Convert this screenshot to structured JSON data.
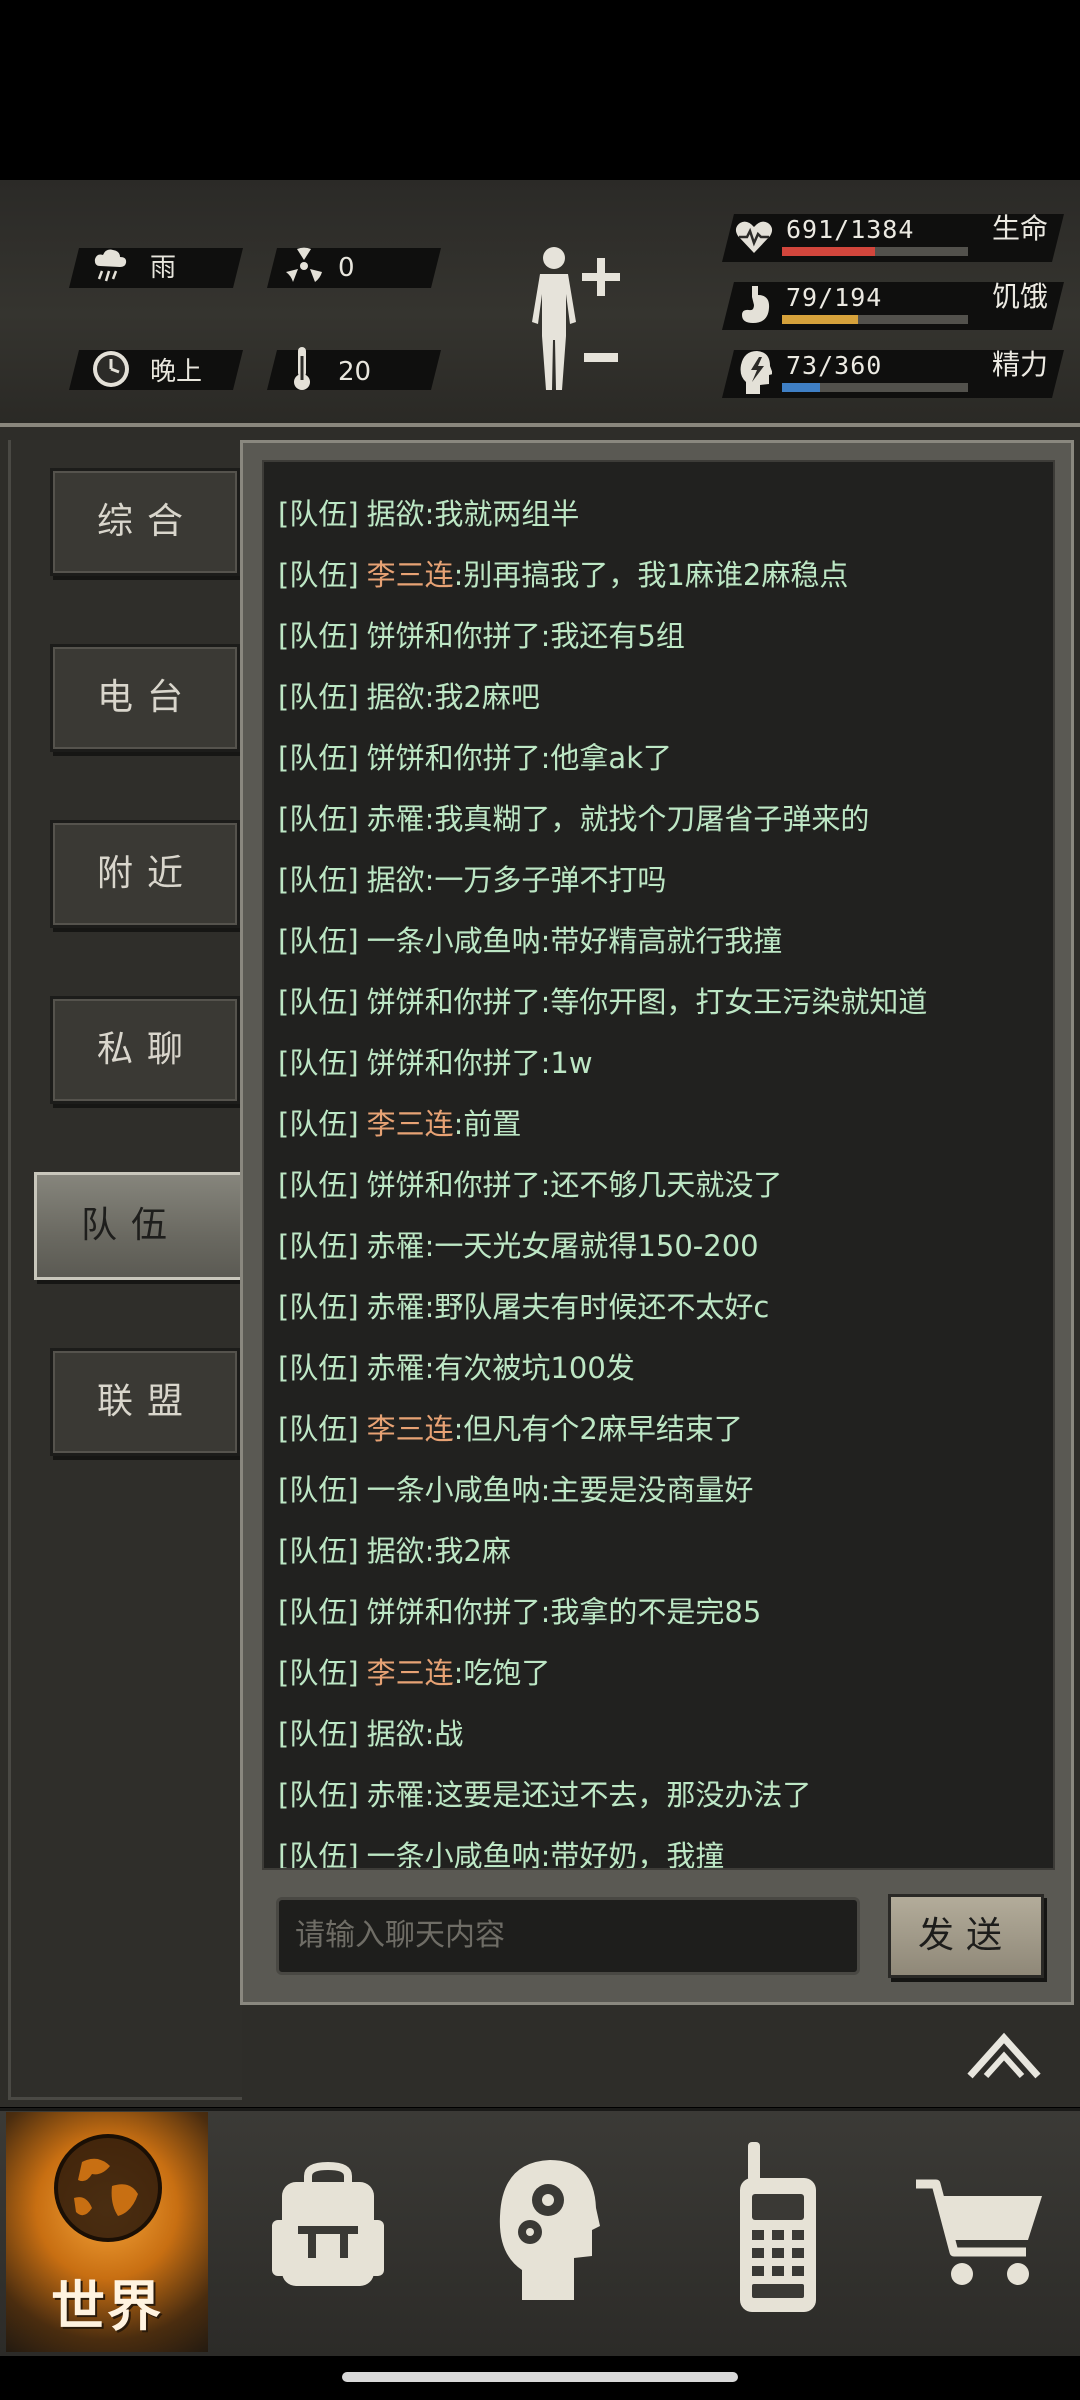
{
  "hud": {
    "weather": {
      "icon": "rain-cloud-icon",
      "label": "雨"
    },
    "radiation": {
      "icon": "radiation-icon",
      "value": "0"
    },
    "time_of_day": {
      "icon": "clock-icon",
      "label": "晚上"
    },
    "temperature": {
      "icon": "thermometer-icon",
      "value": "20"
    },
    "body": {
      "icon": "human-body-icon",
      "plus": "+",
      "minus": "−"
    },
    "stats": [
      {
        "name": "生命",
        "value": "691/1384",
        "fraction": 0.499,
        "color": "#d2463c",
        "icon": "heart-pulse-icon"
      },
      {
        "name": "饥饿",
        "value": "79/194",
        "fraction": 0.407,
        "color": "#d6a23b",
        "icon": "stomach-icon"
      },
      {
        "name": "精力",
        "value": "73/360",
        "fraction": 0.203,
        "color": "#3f7fc4",
        "icon": "head-energy-icon"
      }
    ]
  },
  "tabs": [
    {
      "label": "综合",
      "active": false
    },
    {
      "label": "电台",
      "active": false
    },
    {
      "label": "附近",
      "active": false
    },
    {
      "label": "私聊",
      "active": false
    },
    {
      "label": "队伍",
      "active": true
    },
    {
      "label": "联盟",
      "active": false
    }
  ],
  "chat": {
    "messages": [
      {
        "tag": "[队伍]",
        "sender": "据欲",
        "text": ":我就两组半",
        "highlight": false
      },
      {
        "tag": "[队伍]",
        "sender": "李三连",
        "text": ":别再搞我了，我1麻谁2麻稳点",
        "highlight": true
      },
      {
        "tag": "[队伍]",
        "sender": "饼饼和你拼了",
        "text": ":我还有5组",
        "highlight": false
      },
      {
        "tag": "[队伍]",
        "sender": "据欲",
        "text": ":我2麻吧",
        "highlight": false
      },
      {
        "tag": "[队伍]",
        "sender": "饼饼和你拼了",
        "text": ":他拿ak了",
        "highlight": false
      },
      {
        "tag": "[队伍]",
        "sender": "赤罹",
        "text": ":我真糊了，就找个刀屠省子弹来的",
        "highlight": false
      },
      {
        "tag": "[队伍]",
        "sender": "据欲",
        "text": ":一万多子弹不打吗",
        "highlight": false
      },
      {
        "tag": "[队伍]",
        "sender": "一条小咸鱼呐",
        "text": ":带好精高就行我撞",
        "highlight": false
      },
      {
        "tag": "[队伍]",
        "sender": "饼饼和你拼了",
        "text": ":等你开图，打女王污染就知道",
        "highlight": false
      },
      {
        "tag": "[队伍]",
        "sender": "饼饼和你拼了",
        "text": ":1w",
        "highlight": false
      },
      {
        "tag": "[队伍]",
        "sender": "李三连",
        "text": ":前置",
        "highlight": true
      },
      {
        "tag": "[队伍]",
        "sender": "饼饼和你拼了",
        "text": ":还不够几天就没了",
        "highlight": false
      },
      {
        "tag": "[队伍]",
        "sender": "赤罹",
        "text": ":一天光女屠就得150-200",
        "highlight": false
      },
      {
        "tag": "[队伍]",
        "sender": "赤罹",
        "text": ":野队屠夫有时候还不太好c",
        "highlight": false
      },
      {
        "tag": "[队伍]",
        "sender": "赤罹",
        "text": ":有次被坑100发",
        "highlight": false
      },
      {
        "tag": "[队伍]",
        "sender": "李三连",
        "text": ":但凡有个2麻早结束了",
        "highlight": true
      },
      {
        "tag": "[队伍]",
        "sender": "一条小咸鱼呐",
        "text": ":主要是没商量好",
        "highlight": false
      },
      {
        "tag": "[队伍]",
        "sender": "据欲",
        "text": ":我2麻",
        "highlight": false
      },
      {
        "tag": "[队伍]",
        "sender": "饼饼和你拼了",
        "text": ":我拿的不是完85",
        "highlight": false
      },
      {
        "tag": "[队伍]",
        "sender": "李三连",
        "text": ":吃饱了",
        "highlight": true
      },
      {
        "tag": "[队伍]",
        "sender": "据欲",
        "text": ":战",
        "highlight": false
      },
      {
        "tag": "[队伍]",
        "sender": "赤罹",
        "text": ":这要是还过不去，那没办法了",
        "highlight": false
      },
      {
        "tag": "[队伍]",
        "sender": "一条小咸鱼呐",
        "text": ":带好奶，我撞",
        "highlight": false
      }
    ],
    "input_placeholder": "请输入聊天内容",
    "send_label": "发送",
    "collapse_icon": "double-chevron-up-icon"
  },
  "nav": [
    {
      "label": "世界",
      "icon": "globe-icon",
      "active": true
    },
    {
      "icon": "backpack-icon"
    },
    {
      "icon": "brain-gears-icon"
    },
    {
      "icon": "walkie-talkie-icon"
    },
    {
      "icon": "shopping-cart-icon"
    }
  ],
  "colors": {
    "chat_text": "#bde7c5",
    "chat_highlight_name": "#e7a274",
    "world_orange": "#c86f12"
  }
}
